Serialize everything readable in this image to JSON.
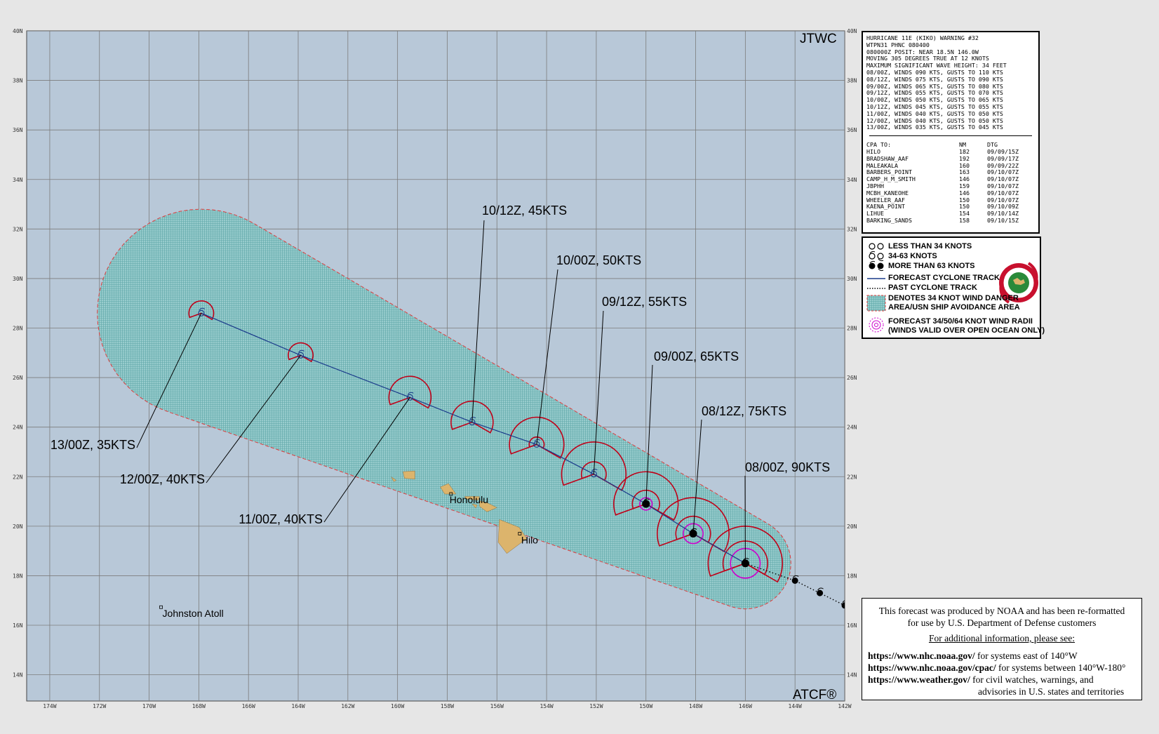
{
  "map": {
    "corner_top_right": "JTWC",
    "corner_bottom_right": "ATCF®",
    "lat_labels": [
      "40N",
      "38N",
      "36N",
      "34N",
      "32N",
      "30N",
      "28N",
      "26N",
      "24N",
      "22N",
      "20N",
      "18N",
      "16N",
      "14N"
    ],
    "lon_labels": [
      "174W",
      "172W",
      "170W",
      "168W",
      "166W",
      "164W",
      "162W",
      "160W",
      "158W",
      "156W",
      "154W",
      "152W",
      "150W",
      "148W",
      "146W",
      "144W",
      "142W"
    ],
    "colors": {
      "ocean": "#b8c8d8",
      "grid": "#7c7c7c",
      "land": "#dcb46c",
      "danger_fill": "#86c8c8",
      "danger_edge": "#e03c3c",
      "radii_34": "#c00018",
      "radii_50": "#c00018",
      "radii_64": "#cc00cc",
      "track": "#1a3a8a"
    },
    "places": [
      {
        "name": "Honolulu",
        "lat": 21.3,
        "lon": -157.85
      },
      {
        "name": "Hilo",
        "lat": 19.7,
        "lon": -155.08
      },
      {
        "name": "Johnston Atoll",
        "lat": 16.73,
        "lon": -169.52
      }
    ]
  },
  "forecast": {
    "points": [
      {
        "label": "08/00Z,  90KTS",
        "time": "08/00Z",
        "kts": 90,
        "lat": 18.5,
        "lon": -146.0,
        "r34": 1.5,
        "r50": 0.9,
        "r64": 0.6,
        "cat": "more_than_63"
      },
      {
        "label": "08/12Z,  75KTS",
        "time": "08/12Z",
        "kts": 75,
        "lat": 19.7,
        "lon": -148.1,
        "r34": 1.45,
        "r50": 0.7,
        "r64": 0.4,
        "cat": "more_than_63"
      },
      {
        "label": "09/00Z,  65KTS",
        "time": "09/00Z",
        "kts": 65,
        "lat": 20.9,
        "lon": -150.0,
        "r34": 1.3,
        "r50": 0.55,
        "r64": 0.25,
        "cat": "more_than_63"
      },
      {
        "label": "09/12Z,  55KTS",
        "time": "09/12Z",
        "kts": 55,
        "lat": 22.1,
        "lon": -152.1,
        "r34": 1.3,
        "r50": 0.5,
        "r64": 0,
        "cat": "34_63"
      },
      {
        "label": "10/00Z,  50KTS",
        "time": "10/00Z",
        "kts": 50,
        "lat": 23.3,
        "lon": -154.4,
        "r34": 1.1,
        "r50": 0.3,
        "r64": 0,
        "cat": "34_63"
      },
      {
        "label": "10/12Z,  45KTS",
        "time": "10/12Z",
        "kts": 45,
        "lat": 24.2,
        "lon": -157.0,
        "r34": 0.85,
        "r50": 0,
        "r64": 0,
        "cat": "34_63"
      },
      {
        "label": "11/00Z,  40KTS",
        "time": "11/00Z",
        "kts": 40,
        "lat": 25.2,
        "lon": -159.5,
        "r34": 0.85,
        "r50": 0,
        "r64": 0,
        "cat": "34_63"
      },
      {
        "label": "12/00Z,  40KTS",
        "time": "12/00Z",
        "kts": 40,
        "lat": 26.9,
        "lon": -163.9,
        "r34": 0.5,
        "r50": 0,
        "r64": 0,
        "cat": "34_63"
      },
      {
        "label": "13/00Z,  35KTS",
        "time": "13/00Z",
        "kts": 35,
        "lat": 28.6,
        "lon": -167.9,
        "r34": 0.5,
        "r50": 0,
        "r64": 0,
        "cat": "34_63"
      }
    ],
    "past_track": [
      {
        "lat": 18.5,
        "lon": -146.0
      },
      {
        "lat": 17.8,
        "lon": -144.0
      },
      {
        "lat": 17.3,
        "lon": -143.0
      },
      {
        "lat": 16.8,
        "lon": -142.0
      },
      {
        "lat": 16.3,
        "lon": -141.0
      }
    ]
  },
  "warning": {
    "header_lines": [
      "HURRICANE 11E (KIKO) WARNING #32",
      "WTPN31 PHNC 080400",
      "080000Z POSIT: NEAR 18.5N 146.0W",
      "MOVING 305 DEGREES TRUE AT 12 KNOTS",
      "MAXIMUM SIGNIFICANT WAVE HEIGHT: 34 FEET",
      "08/00Z, WINDS 090 KTS, GUSTS TO 110 KTS",
      "08/12Z, WINDS 075 KTS, GUSTS TO 090 KTS",
      "09/00Z, WINDS 065 KTS, GUSTS TO 080 KTS",
      "09/12Z, WINDS 055 KTS, GUSTS TO 070 KTS",
      "10/00Z, WINDS 050 KTS, GUSTS TO 065 KTS",
      "10/12Z, WINDS 045 KTS, GUSTS TO 055 KTS",
      "11/00Z, WINDS 040 KTS, GUSTS TO 050 KTS",
      "12/00Z, WINDS 040 KTS, GUSTS TO 050 KTS",
      "13/00Z, WINDS 035 KTS, GUSTS TO 045 KTS"
    ],
    "cpa_header": [
      "CPA TO:",
      "NM",
      "DTG"
    ],
    "cpa_rows": [
      [
        "HILO",
        "182",
        "09/09/15Z"
      ],
      [
        "BRADSHAW_AAF",
        "192",
        "09/09/17Z"
      ],
      [
        "MALEAKALA",
        "160",
        "09/09/22Z"
      ],
      [
        "BARBERS_POINT",
        "163",
        "09/10/07Z"
      ],
      [
        "CAMP_H_M_SMITH",
        "146",
        "09/10/07Z"
      ],
      [
        "JBPHH",
        "159",
        "09/10/07Z"
      ],
      [
        "MCBH_KANEOHE",
        "146",
        "09/10/07Z"
      ],
      [
        "WHEELER_AAF",
        "150",
        "09/10/07Z"
      ],
      [
        "KAENA_POINT",
        "150",
        "09/10/09Z"
      ],
      [
        "LIHUE",
        "154",
        "09/10/14Z"
      ],
      [
        "BARKING_SANDS",
        "158",
        "09/10/15Z"
      ]
    ]
  },
  "legend": {
    "items": [
      "LESS THAN 34 KNOTS",
      "34-63 KNOTS",
      "MORE THAN 63 KNOTS",
      "FORECAST CYCLONE TRACK",
      "PAST CYCLONE TRACK",
      "DENOTES 34 KNOT WIND DANGER",
      "AREA/USN SHIP AVOIDANCE AREA",
      "FORECAST 34/50/64 KNOT WIND RADII",
      "(WINDS VALID OVER OPEN OCEAN ONLY)"
    ]
  },
  "credit": {
    "line1": "This forecast was produced by NOAA and has been re-formatted",
    "line2": "for use by U.S. Department of Defense customers",
    "line3": "For additional information, please see:",
    "links": [
      {
        "url": "https://www.nhc.noaa.gov/",
        "desc": "  for systems east of 140°W"
      },
      {
        "url": "https://www.nhc.noaa.gov/cpac/",
        "desc": "  for systems between 140°W-180°"
      },
      {
        "url": "https://www.weather.gov/",
        "desc": "  for civil watches, warnings, and"
      }
    ],
    "line_last": "advisories in U.S. states and territories"
  }
}
